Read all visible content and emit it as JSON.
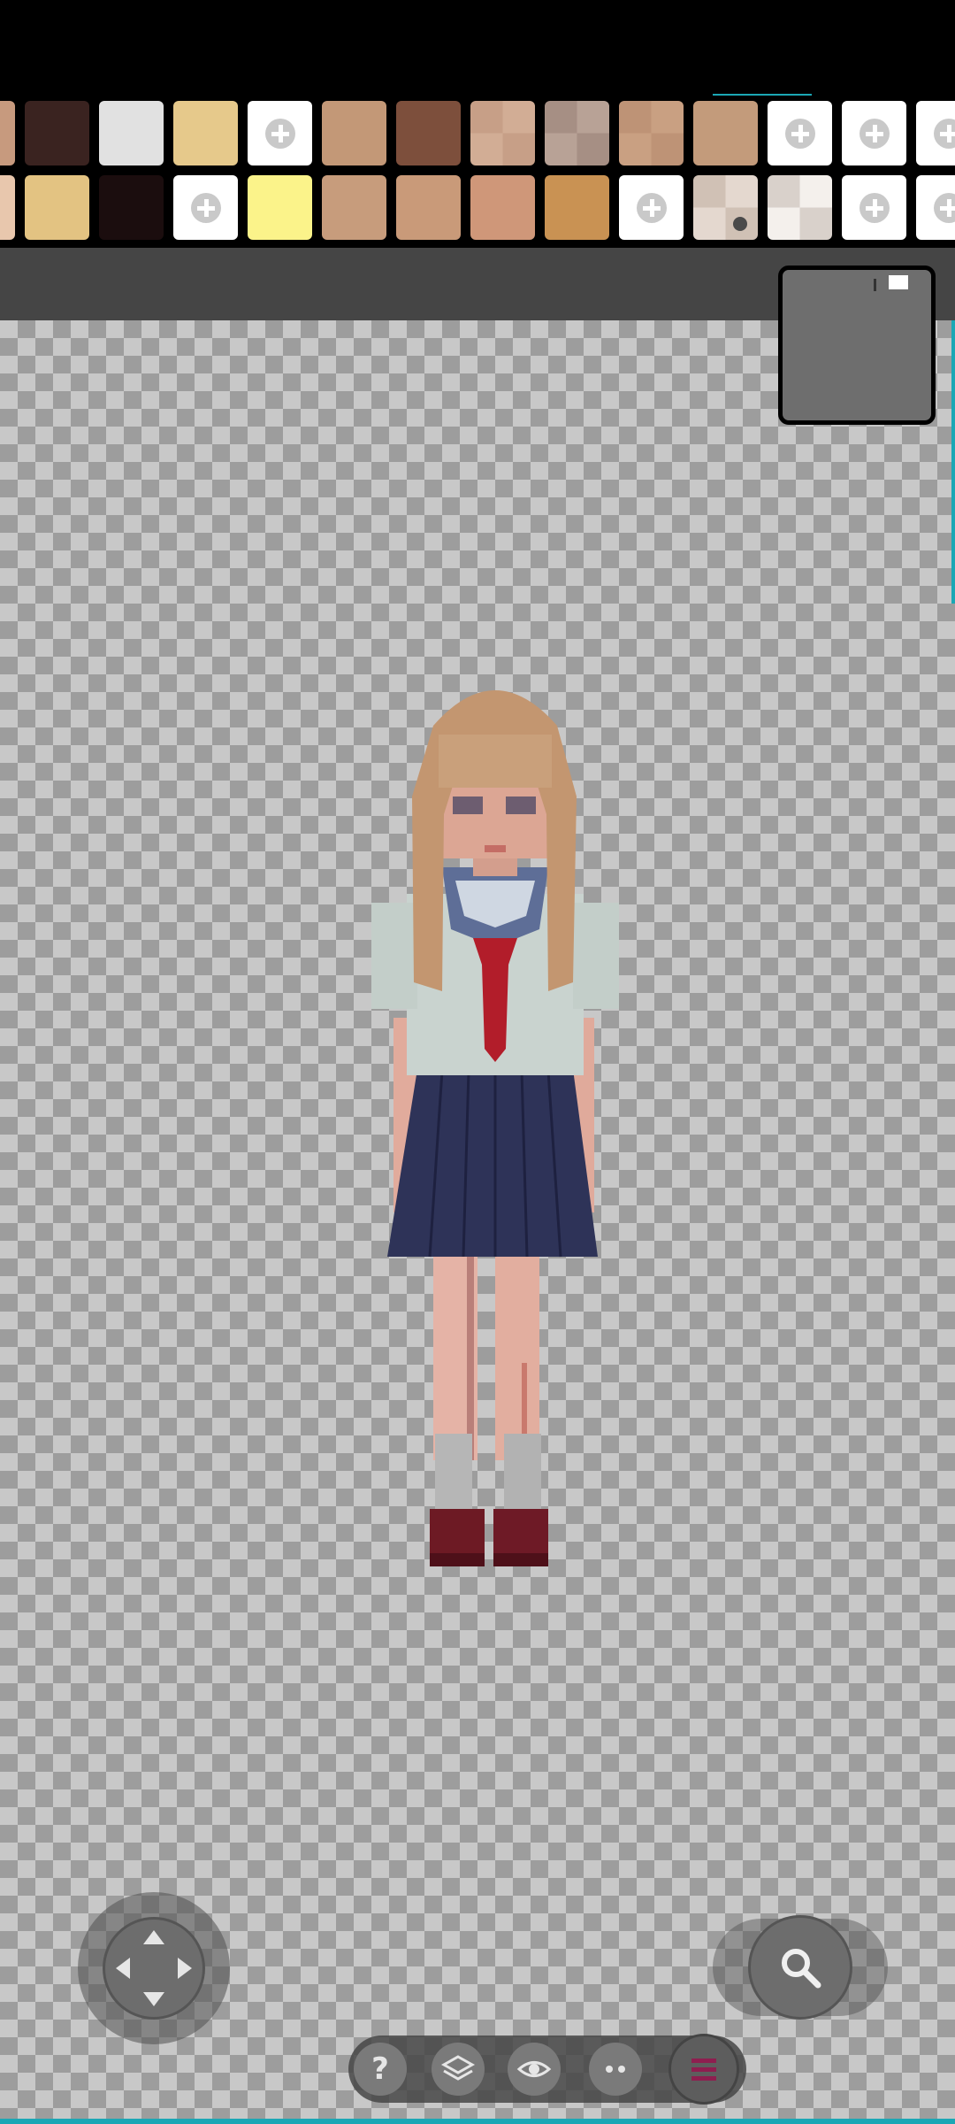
{
  "palette": {
    "row1": [
      {
        "type": "color",
        "color": "#c79a7e"
      },
      {
        "type": "color",
        "color": "#3a2320"
      },
      {
        "type": "color",
        "color": "#e1e1e1"
      },
      {
        "type": "color",
        "color": "#e6c98b"
      },
      {
        "type": "add"
      },
      {
        "type": "color",
        "color": "#c39877"
      },
      {
        "type": "color",
        "color": "#7d4f3c"
      },
      {
        "type": "checker",
        "c1": "#d2ad95",
        "c2": "#c79f87"
      },
      {
        "type": "checker",
        "c1": "#b8a296",
        "c2": "#a68f84"
      },
      {
        "type": "checker",
        "c1": "#c9a082",
        "c2": "#be9376"
      },
      {
        "type": "color",
        "color": "#c39b7b"
      },
      {
        "type": "add"
      },
      {
        "type": "add"
      },
      {
        "type": "add"
      }
    ],
    "row2": [
      {
        "type": "color",
        "color": "#e8c7ad"
      },
      {
        "type": "color",
        "color": "#e3c382"
      },
      {
        "type": "color",
        "color": "#1b0d0e"
      },
      {
        "type": "add"
      },
      {
        "type": "color",
        "color": "#fbf38a"
      },
      {
        "type": "color",
        "color": "#c79c7c"
      },
      {
        "type": "color",
        "color": "#c99a79"
      },
      {
        "type": "color",
        "color": "#cf9779"
      },
      {
        "type": "color",
        "color": "#c99253"
      },
      {
        "type": "add"
      },
      {
        "type": "checker",
        "c1": "#e4d8cf",
        "c2": "#d0c1b5",
        "dot": true
      },
      {
        "type": "checker",
        "c1": "#f4f0ec",
        "c2": "#d9d1cb"
      },
      {
        "type": "add"
      },
      {
        "type": "add"
      }
    ]
  },
  "icons": {
    "dpad": "move-arrows-icon",
    "zoom": "magnifier-icon",
    "help": "help-icon",
    "layers": "layers-icon",
    "visibility": "eye-icon",
    "more": "more-dots-icon",
    "menu": "hamburger-menu-icon"
  },
  "bottombar": {
    "help_label": "?"
  },
  "colors": {
    "accent": "#1ba7b5",
    "menu_accent": "#8e1e4f",
    "toolstrip": "#454545"
  }
}
